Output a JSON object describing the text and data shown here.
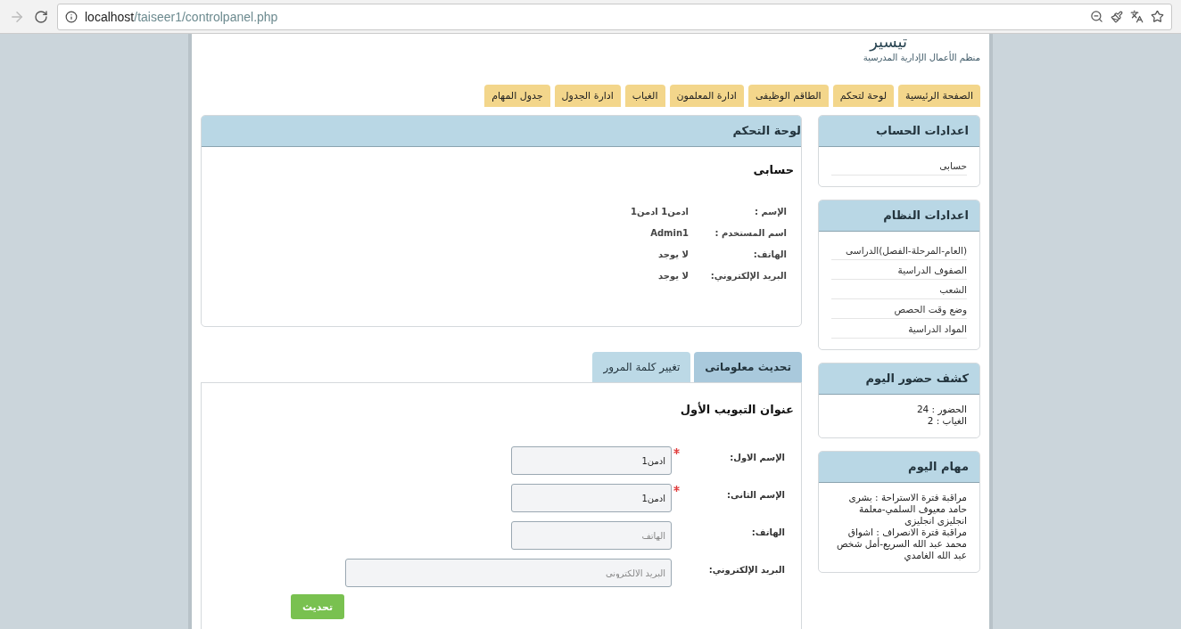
{
  "browser": {
    "url_host": "localhost",
    "url_path": "/taiseer1/controlpanel.php"
  },
  "header": {
    "logo": "تيسير",
    "tagline": "منظم الأعمال الإدارية المدرسية"
  },
  "nav_tabs": [
    {
      "label": "الصفحة الرئيسية"
    },
    {
      "label": "لوحة لتحكم"
    },
    {
      "label": "الطاقم الوظيفى"
    },
    {
      "label": "ادارة المعلمون"
    },
    {
      "label": "الغياب"
    },
    {
      "label": "ادارة الجدول"
    },
    {
      "label": "جدول المهام"
    }
  ],
  "main_panel": {
    "title": "لوحة التحكم",
    "heading": "حسابى",
    "info": [
      {
        "label": "الإسم :",
        "value": "ادمن1 ادمن1"
      },
      {
        "label": "اسم المستخدم :",
        "value": "Admin1"
      },
      {
        "label": "الهاتف:",
        "value": "لا يوجد"
      },
      {
        "label": "البريد الإلكتروني:",
        "value": "لا يوجد"
      }
    ]
  },
  "form_tabs": [
    {
      "label": "تحديث معلوماتى",
      "selected": true
    },
    {
      "label": "تغيير كلمة المرور",
      "selected": false
    }
  ],
  "form": {
    "heading": "عنوان التبويب الأول",
    "fields": [
      {
        "label": "الإسم الاول:",
        "value": "ادمن1",
        "required": true,
        "wide": false
      },
      {
        "label": "الإسم الثانى:",
        "value": "ادمن1",
        "required": true,
        "wide": false
      },
      {
        "label": "الهاتف:",
        "placeholder": "الهاتف",
        "required": false,
        "wide": false
      },
      {
        "label": "البريد الإلكتروني:",
        "placeholder": "البريد الالكترونى",
        "required": false,
        "wide": true
      }
    ],
    "submit": "تحديث"
  },
  "sidebar": [
    {
      "kind": "menu",
      "title": "اعدادات الحساب",
      "items": [
        "حسابى"
      ]
    },
    {
      "kind": "menu",
      "title": "اعدادات النظام",
      "items": [
        "(العام-المرحلة-الفصل)الدراسى",
        "الصفوف الدراسية",
        "الشعب",
        "وضع وقت الحصص",
        "المواد الدراسية"
      ]
    },
    {
      "kind": "text",
      "title": "كشف حضور اليوم",
      "lines": [
        "الحضور : 24",
        "الغياب : 2"
      ]
    },
    {
      "kind": "text",
      "title": "مهام اليوم",
      "lines": [
        "مراقبة فترة الاستراحة : بشرى حامد معيوف السلمي-معلمة انجليزى انجليزى",
        "مراقبة فترة الانصراف : اشواق محمد عبد الله السريع-أمل شخص عبد الله الغامدي"
      ]
    }
  ]
}
